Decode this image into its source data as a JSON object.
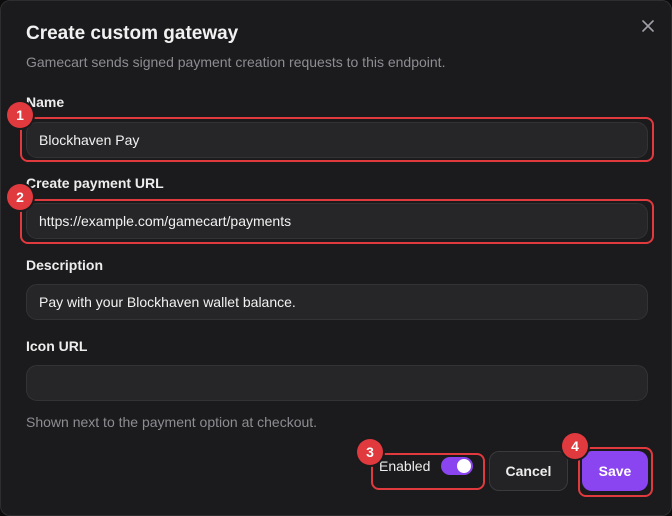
{
  "dialog": {
    "title": "Create custom gateway",
    "subtitle": "Gamecart sends signed payment creation requests to this endpoint.",
    "close_icon": "close-icon"
  },
  "fields": {
    "name": {
      "label": "Name",
      "value": "Blockhaven Pay"
    },
    "payment_url": {
      "label": "Create payment URL",
      "value": "https://example.com/gamecart/payments"
    },
    "description": {
      "label": "Description",
      "value": "Pay with your Blockhaven wallet balance."
    },
    "icon_url": {
      "label": "Icon URL",
      "value": "",
      "hint": "Shown next to the payment option at checkout."
    }
  },
  "footer": {
    "enabled_label": "Enabled",
    "enabled": true,
    "cancel_label": "Cancel",
    "save_label": "Save"
  },
  "annotations": [
    "1",
    "2",
    "3",
    "4"
  ],
  "colors": {
    "accent": "#8b45f0",
    "highlight": "#e0393e",
    "panel": "#1b1b1d",
    "input": "#262628"
  }
}
